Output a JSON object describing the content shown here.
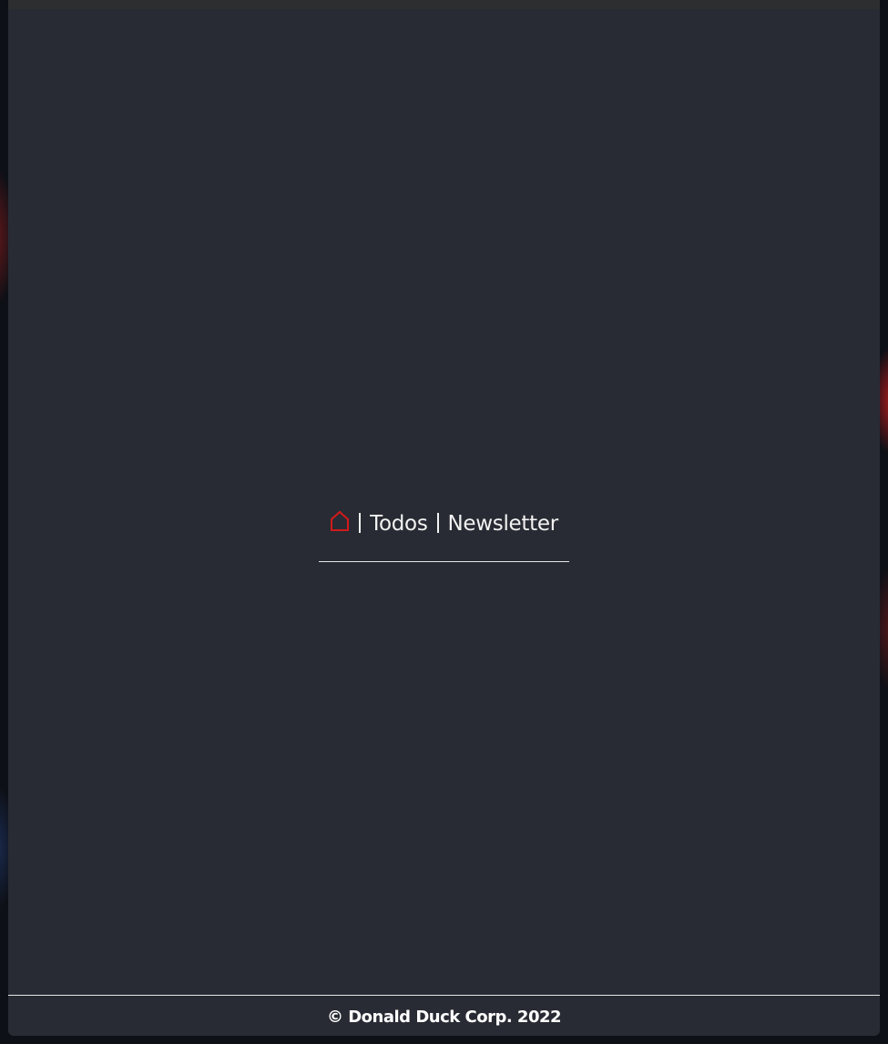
{
  "nav": {
    "home_icon": "home-icon",
    "home_icon_color": "#d11a1a",
    "items": [
      {
        "label": "Todos"
      },
      {
        "label": "Newsletter"
      }
    ]
  },
  "footer": {
    "copyright": "© Donald Duck Corp. 2022"
  },
  "colors": {
    "panel_bg": "#282b33",
    "text": "#f2f2f2",
    "accent": "#d11a1a"
  }
}
